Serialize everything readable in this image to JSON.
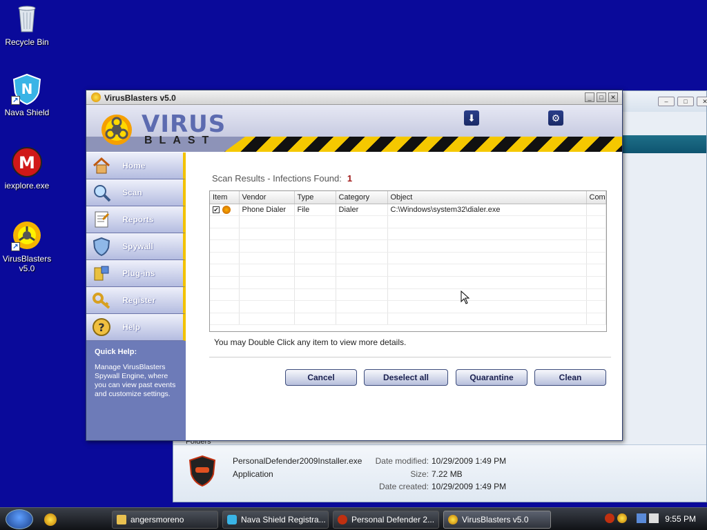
{
  "desktop": {
    "icons": [
      {
        "label": "Recycle Bin",
        "icon": "recycle-bin-icon"
      },
      {
        "label": "Nava Shield",
        "icon": "nava-shield-icon"
      },
      {
        "label": "iexplore.exe",
        "icon": "iexplore-icon"
      },
      {
        "label": "VirusBlasters v5.0",
        "icon": "virusblasters-icon"
      }
    ]
  },
  "bg_window": {
    "partial_row": "Folders",
    "details": {
      "name": "PersonalDefender2009Installer.exe",
      "type": "Application",
      "modified_label": "Date modified:",
      "modified_value": "10/29/2009 1:49 PM",
      "size_label": "Size:",
      "size_value": "7.22 MB",
      "created_label": "Date created:",
      "created_value": "10/29/2009 1:49 PM"
    }
  },
  "app": {
    "title": "VirusBlasters v5.0",
    "brand_line1": "VIRUS",
    "brand_line2": "BLAST",
    "nav": [
      {
        "label": "Home",
        "icon": "home-icon"
      },
      {
        "label": "Scan",
        "icon": "scan-icon"
      },
      {
        "label": "Reports",
        "icon": "reports-icon"
      },
      {
        "label": "Spywall",
        "icon": "spywall-icon"
      },
      {
        "label": "Plug-ins",
        "icon": "plugins-icon"
      },
      {
        "label": "Register",
        "icon": "register-icon"
      },
      {
        "label": "Help",
        "icon": "help-icon"
      }
    ],
    "quick_help_title": "Quick Help:",
    "quick_help_text": "Manage VirusBlasters Spywall Engine, where you can view past events and customize settings.",
    "scan_title": "Scan Results - Infections Found:",
    "scan_count": "1",
    "columns": [
      "Item",
      "Vendor",
      "Type",
      "Category",
      "Object",
      "Comr"
    ],
    "rows": [
      {
        "checked": "✔",
        "vendor": "Phone Dialer",
        "type": "File",
        "category": "Dialer",
        "object": "C:\\Windows\\system32\\dialer.exe",
        "comment": ""
      }
    ],
    "hint": "You may Double Click any item to view more details.",
    "buttons": {
      "cancel": "Cancel",
      "deselect": "Deselect all",
      "quarantine": "Quarantine",
      "clean": "Clean"
    }
  },
  "taskbar": {
    "items": [
      {
        "label": "angersmoreno"
      },
      {
        "label": "Nava Shield Registra..."
      },
      {
        "label": "Personal Defender 2..."
      },
      {
        "label": "VirusBlasters v5.0"
      }
    ],
    "clock": "9:55 PM"
  }
}
